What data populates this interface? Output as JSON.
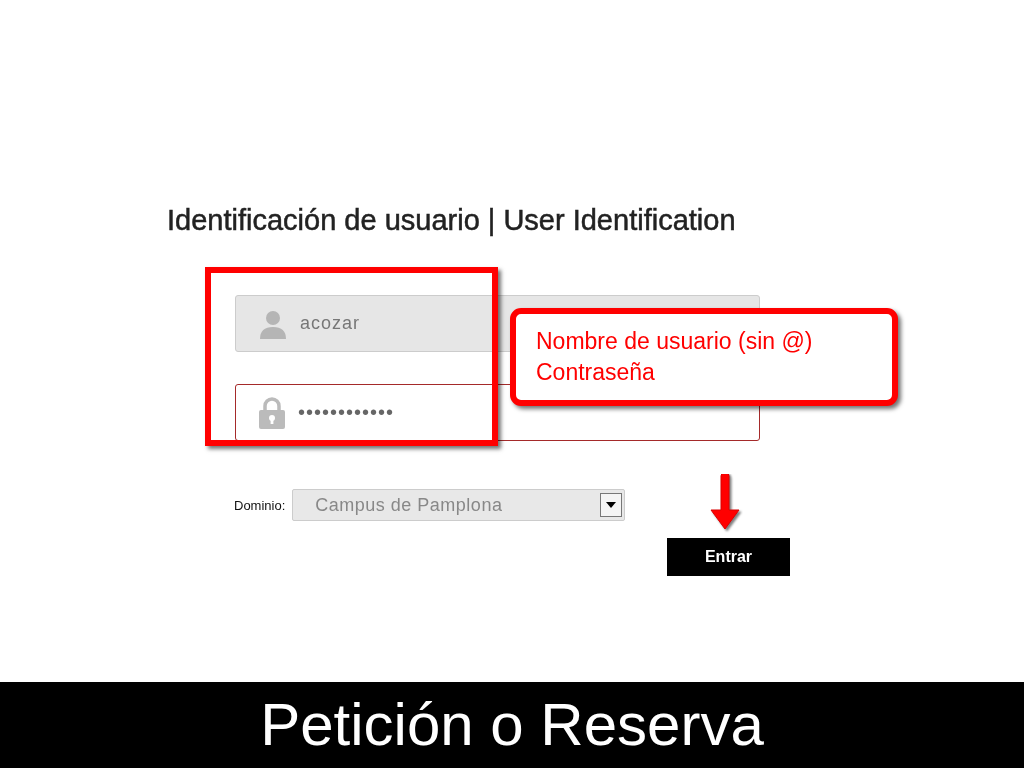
{
  "form": {
    "title": "Identificación de usuario | User Identification",
    "username": {
      "value": "acozar"
    },
    "password": {
      "value": "••••••••••••"
    },
    "domain": {
      "label": "Dominio:",
      "value": "Campus de Pamplona"
    },
    "submit": "Entrar"
  },
  "annotation": {
    "text": "Nombre de usuario (sin @)\nContraseña"
  },
  "footer": {
    "title": "Petición o Reserva"
  }
}
